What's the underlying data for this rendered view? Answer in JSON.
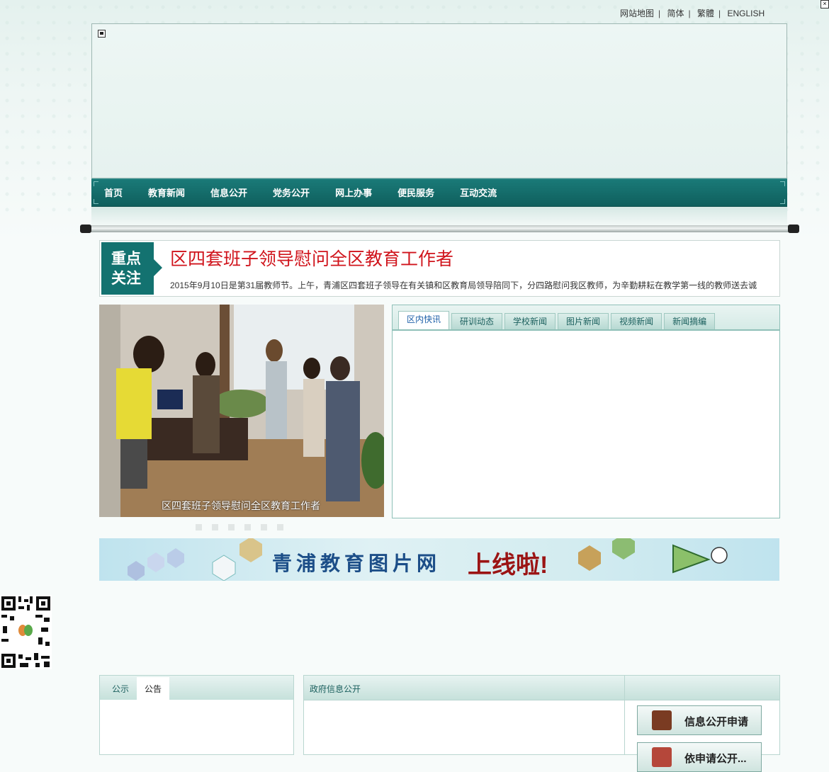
{
  "top_links": [
    "网站地图",
    "简体",
    "繁體",
    "ENGLISH"
  ],
  "close_label": "×",
  "nav": [
    "首页",
    "教育新闻",
    "信息公开",
    "党务公开",
    "网上办事",
    "便民服务",
    "互动交流"
  ],
  "focus": {
    "tag_line1": "重点",
    "tag_line2": "关注",
    "headline": "区四套班子领导慰问全区教育工作者",
    "summary": "2015年9月10日是第31届教师节。上午，青浦区四套班子领导在有关镇和区教育局领导陪同下，分四路慰问我区教师，为辛勤耕耘在教学第一线的教师送去诚"
  },
  "slider": {
    "caption": "区四套班子领导慰问全区教育工作者",
    "dots": 6,
    "active_dot": 0
  },
  "news_tabs": [
    "区内快讯",
    "研训动态",
    "学校新闻",
    "图片新闻",
    "视频新闻",
    "新闻摘编"
  ],
  "news_active_tab": 0,
  "ad": {
    "title": "青浦教育图片网",
    "title2": "上线啦!"
  },
  "notice_tabs": [
    "公示",
    "公告"
  ],
  "notice_active_tab": 1,
  "gov": {
    "title": "政府信息公开",
    "buttons": [
      "信息公开申请",
      "依申请公开..."
    ]
  },
  "colors": {
    "nav": "#137270",
    "headline": "#d0141c",
    "accent_tab": "#1d5fa8"
  }
}
